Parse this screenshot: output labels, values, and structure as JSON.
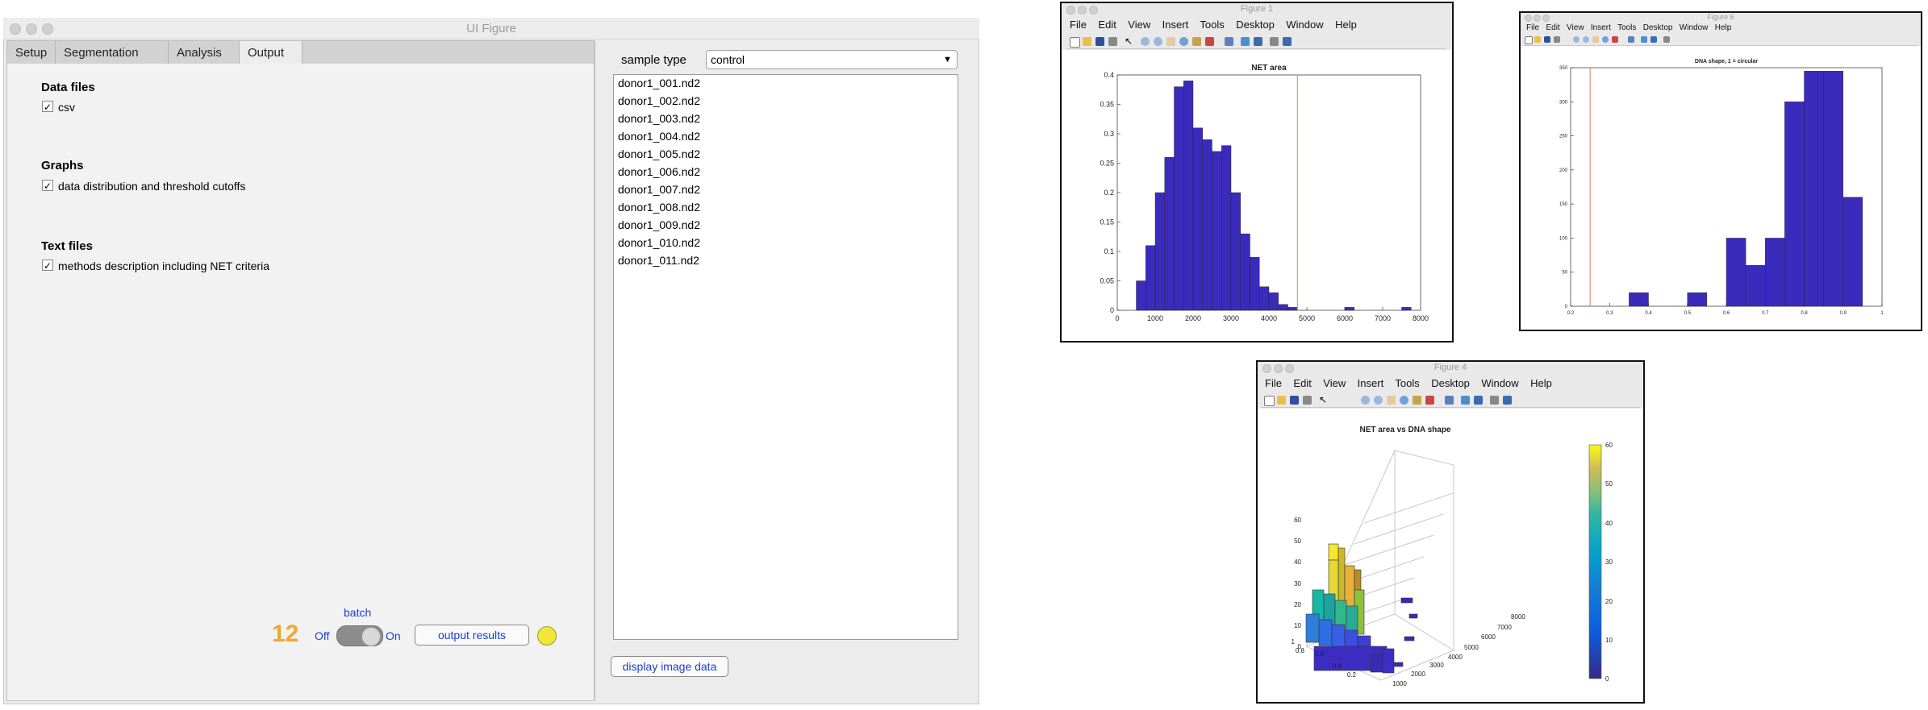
{
  "ui_window": {
    "title": "UI Figure",
    "tabs": [
      "Setup",
      "Segmentation",
      "Analysis",
      "Output"
    ],
    "active_tab": "Output",
    "sections": [
      {
        "title": "Data files",
        "checkbox_label": "csv",
        "checked": true
      },
      {
        "title": "Graphs",
        "checkbox_label": "data distribution and threshold cutoffs",
        "checked": true
      },
      {
        "title": "Text files",
        "checkbox_label": "methods description including NET criteria",
        "checked": true
      }
    ],
    "sample_type_label": "sample type",
    "sample_type_value": "control",
    "files": [
      "donor1_001.nd2",
      "donor1_002.nd2",
      "donor1_003.nd2",
      "donor1_004.nd2",
      "donor1_005.nd2",
      "donor1_006.nd2",
      "donor1_007.nd2",
      "donor1_008.nd2",
      "donor1_009.nd2",
      "donor1_010.nd2",
      "donor1_011.nd2"
    ],
    "counter": "12",
    "batch_label": "batch",
    "switch_off": "Off",
    "switch_on": "On",
    "output_button": "output results",
    "display_button": "display image data",
    "lamp_color": "#f2e63a",
    "counter_color": "#f0a830"
  },
  "figure1": {
    "title": "Figure 1",
    "menu": [
      "File",
      "Edit",
      "View",
      "Insert",
      "Tools",
      "Desktop",
      "Window",
      "Help"
    ],
    "chart_data": {
      "type": "bar",
      "title": "NET area",
      "x_ticks": [
        "0",
        "1000",
        "2000",
        "3000",
        "4000",
        "5000",
        "6000",
        "7000",
        "8000"
      ],
      "y_ticks": [
        "0",
        "0.05",
        "0.1",
        "0.15",
        "0.2",
        "0.25",
        "0.3",
        "0.35",
        "0.4"
      ],
      "xlim": [
        0,
        8000
      ],
      "ylim": [
        0,
        0.4
      ],
      "bin_width": 250,
      "bins_start": [
        500,
        750,
        1000,
        1250,
        1500,
        1750,
        2000,
        2250,
        2500,
        2750,
        3000,
        3250,
        3500,
        3750,
        4000,
        4250,
        4500,
        6000,
        7500
      ],
      "values": [
        0.05,
        0.11,
        0.2,
        0.26,
        0.38,
        0.39,
        0.31,
        0.29,
        0.27,
        0.28,
        0.2,
        0.13,
        0.09,
        0.04,
        0.03,
        0.01,
        0.005,
        0.005,
        0.005
      ],
      "threshold_x": 4750,
      "bar_color": "#3b2bbd",
      "threshold_color": "#e8785c"
    }
  },
  "figure6": {
    "title": "Figure 6",
    "menu": [
      "File",
      "Edit",
      "View",
      "Insert",
      "Tools",
      "Desktop",
      "Window",
      "Help"
    ],
    "chart_data": {
      "type": "bar",
      "title": "DNA shape, 1 = circular",
      "x_ticks": [
        "0.2",
        "0.3",
        "0.4",
        "0.5",
        "0.6",
        "0.7",
        "0.8",
        "0.9",
        "1"
      ],
      "y_ticks": [
        "0",
        "50",
        "100",
        "150",
        "200",
        "250",
        "300",
        "350"
      ],
      "xlim": [
        0.2,
        1.0
      ],
      "ylim": [
        0,
        350
      ],
      "bin_width": 0.05,
      "bins_start": [
        0.35,
        0.5,
        0.6,
        0.65,
        0.7,
        0.75,
        0.8,
        0.85,
        0.9
      ],
      "values": [
        20,
        20,
        100,
        60,
        100,
        300,
        345,
        345,
        160
      ],
      "threshold_x": 0.25,
      "bar_color": "#3b2bbd",
      "threshold_color": "#e8785c"
    }
  },
  "figure4": {
    "title": "Figure 4",
    "menu": [
      "File",
      "Edit",
      "View",
      "Insert",
      "Tools",
      "Desktop",
      "Window",
      "Help"
    ],
    "chart_data": {
      "type": "bar3d",
      "title": "NET area vs DNA shape",
      "z_ticks": [
        "0",
        "10",
        "20",
        "30",
        "40",
        "50",
        "60"
      ],
      "colorbar_ticks": [
        "0",
        "10",
        "20",
        "30",
        "40",
        "50",
        "60"
      ],
      "x_ticks": [
        "1000",
        "2000",
        "3000",
        "4000",
        "5000",
        "6000",
        "7000",
        "8000"
      ],
      "y_ticks": [
        "0.2",
        "0.4",
        "0.6",
        "0.8",
        "1"
      ]
    }
  }
}
